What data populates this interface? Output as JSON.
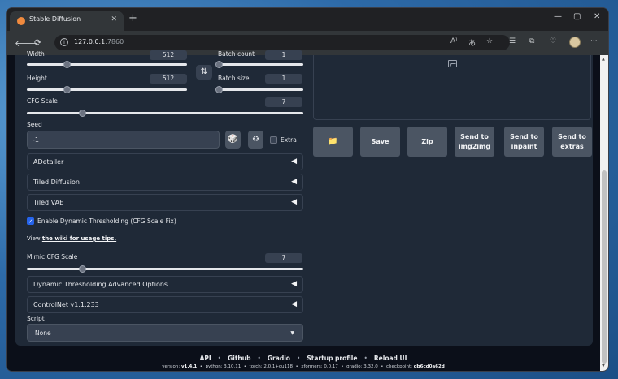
{
  "browser": {
    "tab_title": "Stable Diffusion",
    "tab_close": "✕",
    "new_tab": "+",
    "url_host": "127.0.0.1",
    "url_port": ":7860",
    "controls": {
      "minimize": "—",
      "maximize": "▢",
      "close": "✕"
    }
  },
  "left": {
    "width": {
      "label": "Width",
      "value": "512",
      "level": 0.25
    },
    "height": {
      "label": "Height",
      "value": "512",
      "level": 0.25
    },
    "batch_count": {
      "label": "Batch count",
      "value": "1",
      "level": 0.0
    },
    "batch_size": {
      "label": "Batch size",
      "value": "1",
      "level": 0.0
    },
    "cfg_scale": {
      "label": "CFG Scale",
      "value": "7",
      "level": 0.2
    },
    "swap_icon": "⇅",
    "seed": {
      "label": "Seed",
      "value": "-1",
      "dice_icon": "🎲",
      "recycle_icon": "♻",
      "extra_label": "Extra",
      "extra_checked": false
    },
    "accordions": [
      {
        "label": "ADetailer",
        "arrow": "◀"
      },
      {
        "label": "Tiled Diffusion",
        "arrow": "◀"
      },
      {
        "label": "Tiled VAE",
        "arrow": "◀"
      }
    ],
    "dynamic_thresholding": {
      "label": "Enable Dynamic Thresholding (CFG Scale Fix)",
      "checked": true
    },
    "tips": {
      "prefix": "View ",
      "link": "the wiki for usage tips."
    },
    "mimic_cfg": {
      "label": "Mimic CFG Scale",
      "value": "7",
      "level": 0.2
    },
    "accordions2": [
      {
        "label": "Dynamic Thresholding Advanced Options",
        "arrow": "◀"
      },
      {
        "label": "ControlNet v1.1.233",
        "arrow": "◀"
      }
    ],
    "script": {
      "label": "Script",
      "value": "None",
      "caret": "▼"
    }
  },
  "right": {
    "buttons": [
      {
        "label": "📁"
      },
      {
        "label": "Save"
      },
      {
        "label": "Zip"
      },
      {
        "label": "Send to img2img"
      },
      {
        "label": "Send to inpaint"
      },
      {
        "label": "Send to extras"
      }
    ]
  },
  "footer": {
    "links": [
      "API",
      "Github",
      "Gradio",
      "Startup profile",
      "Reload UI"
    ],
    "separator": "•",
    "version_label": "version: ",
    "version": "v1.4.1",
    "python_label": "python: ",
    "python": "3.10.11",
    "torch_label": "torch: ",
    "torch": "2.0.1+cu118",
    "xformers_label": "xformers: ",
    "xformers": "0.0.17",
    "gradio_label": "gradio: ",
    "gradio": "3.32.0",
    "checkpoint_label": "checkpoint: ",
    "checkpoint": "db6cd0a62d"
  },
  "colors": {
    "accent": "#2563eb",
    "slider_track": "#e5e7eb",
    "panel": "#1f2937",
    "button": "#4b5563"
  }
}
